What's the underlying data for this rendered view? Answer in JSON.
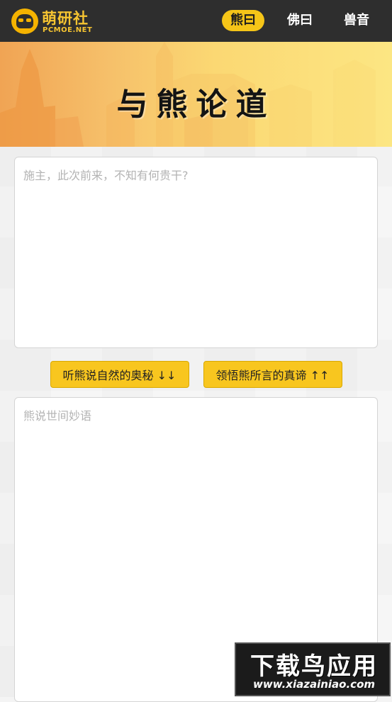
{
  "header": {
    "logo_title": "萌研社",
    "logo_sub": "PCMOE.NET",
    "nav": [
      {
        "label": "熊曰",
        "active": true
      },
      {
        "label": "佛曰",
        "active": false
      },
      {
        "label": "兽音",
        "active": false
      }
    ]
  },
  "banner": {
    "title": "与熊论道"
  },
  "input": {
    "placeholder": "施主，此次前来，不知有何贵干?"
  },
  "buttons": {
    "decode_label": "听熊说自然的奥秘 ↓↓",
    "encode_label": "领悟熊所言的真谛 ↑↑"
  },
  "output": {
    "placeholder": "熊说世间妙语"
  },
  "watermark": {
    "main": "下载鸟应用",
    "url": "www.xiazainiao.com"
  },
  "colors": {
    "accent": "#f5c518",
    "topbar": "#2e2e2e"
  }
}
